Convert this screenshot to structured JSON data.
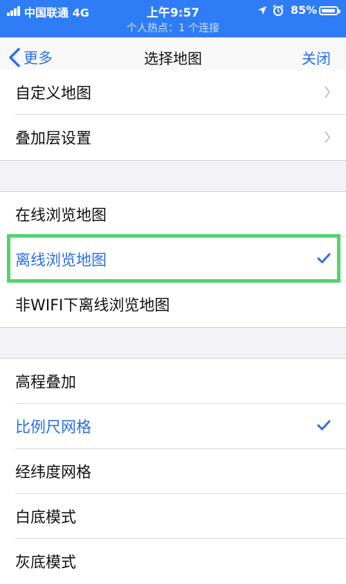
{
  "status_bar": {
    "carrier": "中国联通  4G",
    "time": "上午9:57",
    "battery": "85%",
    "hotspot": "个人热点：1 个连接"
  },
  "nav": {
    "back_label": "更多",
    "title": "选择地图",
    "close_label": "关闭"
  },
  "sections": [
    {
      "items": [
        {
          "label": "自定义地图",
          "accessory": "chevron"
        },
        {
          "label": "叠加层设置",
          "accessory": "chevron"
        }
      ]
    },
    {
      "items": [
        {
          "label": "在线浏览地图",
          "accessory": "none"
        },
        {
          "label": "离线浏览地图",
          "accessory": "check",
          "selected": true
        },
        {
          "label": "非WIFI下离线浏览地图",
          "accessory": "none"
        }
      ]
    },
    {
      "items": [
        {
          "label": "高程叠加",
          "accessory": "none"
        },
        {
          "label": "比例尺网格",
          "accessory": "check",
          "selected": true
        },
        {
          "label": "经纬度网格",
          "accessory": "none"
        },
        {
          "label": "白底模式",
          "accessory": "none"
        },
        {
          "label": "灰底模式",
          "accessory": "none"
        }
      ]
    }
  ],
  "colors": {
    "accent": "#2a6ee8",
    "status_bar": "#2f7df6",
    "highlight": "#52d36a"
  }
}
